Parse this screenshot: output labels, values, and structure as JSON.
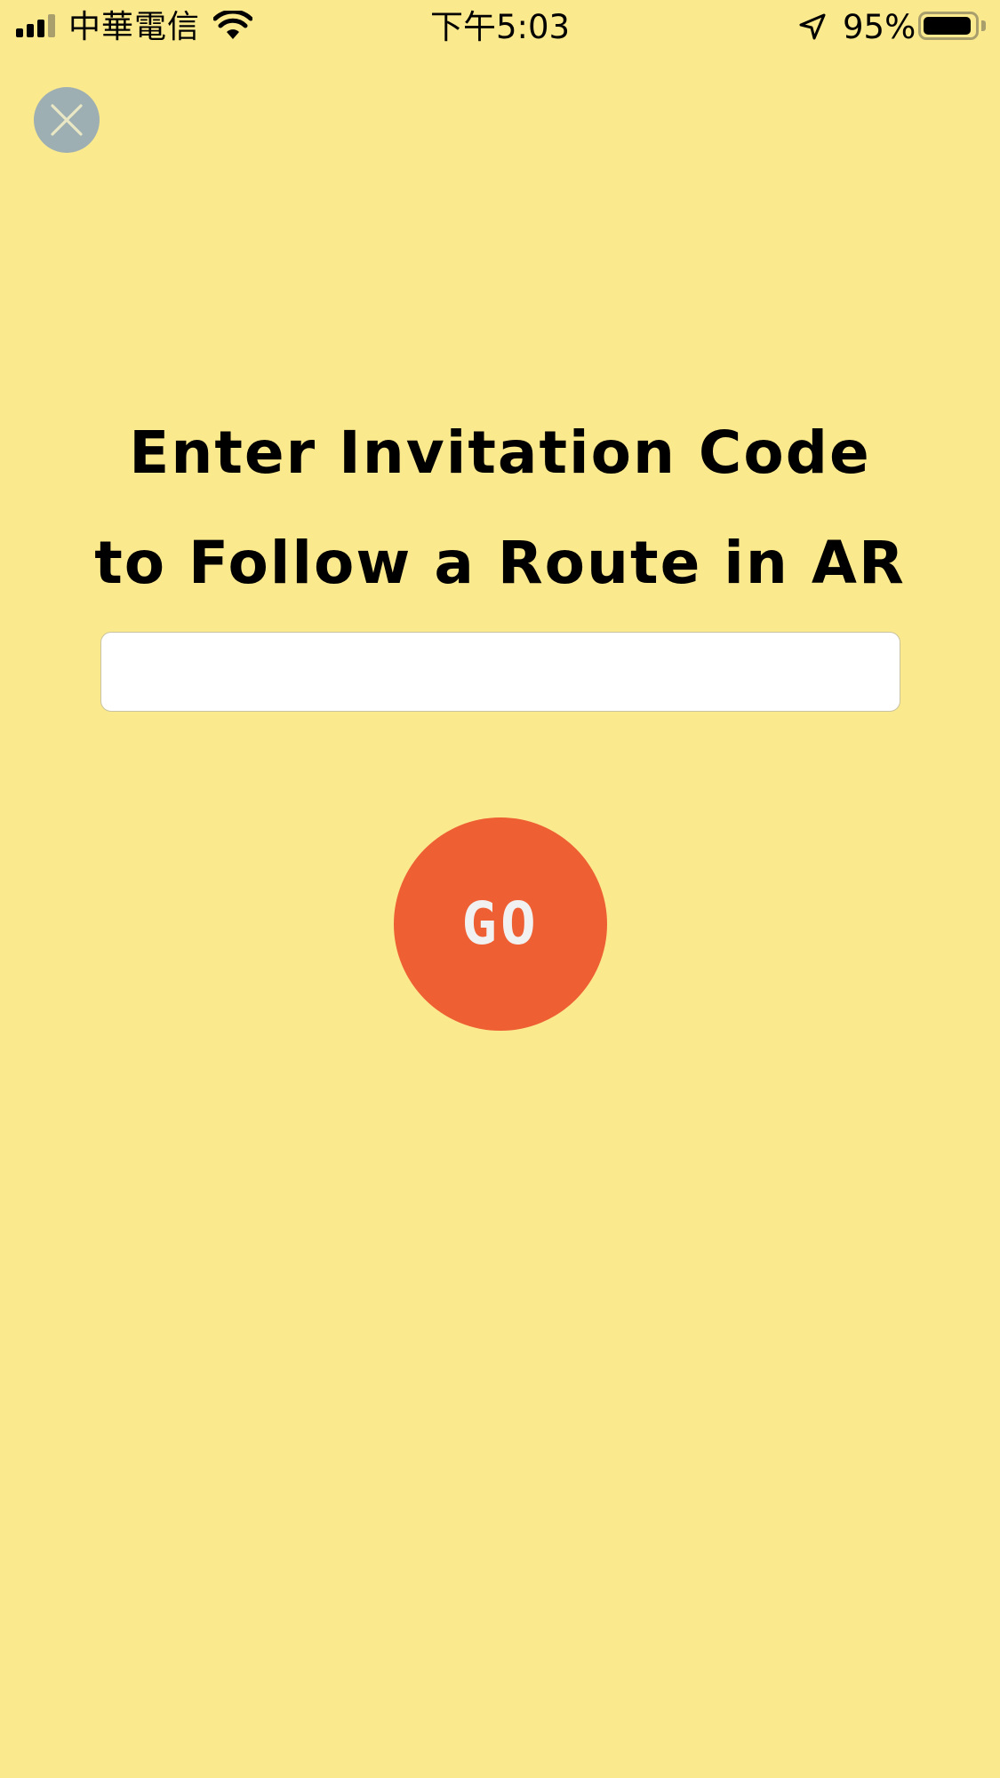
{
  "theme": {
    "background": "#fbe98e",
    "accent": "#ee5f33",
    "close_button_bg": "#9dafb2"
  },
  "status_bar": {
    "carrier": "中華電信",
    "time": "下午5:03",
    "battery_percent": "95%",
    "battery_level": 0.95,
    "icons": [
      "signal-icon",
      "wifi-icon",
      "location-arrow-icon",
      "battery-icon"
    ]
  },
  "close_button": {
    "icon": "close-icon"
  },
  "title": {
    "line1": "Enter Invitation Code",
    "line2": "to Follow a Route in AR"
  },
  "code_input": {
    "value": "",
    "placeholder": ""
  },
  "go_button": {
    "label": "GO"
  }
}
